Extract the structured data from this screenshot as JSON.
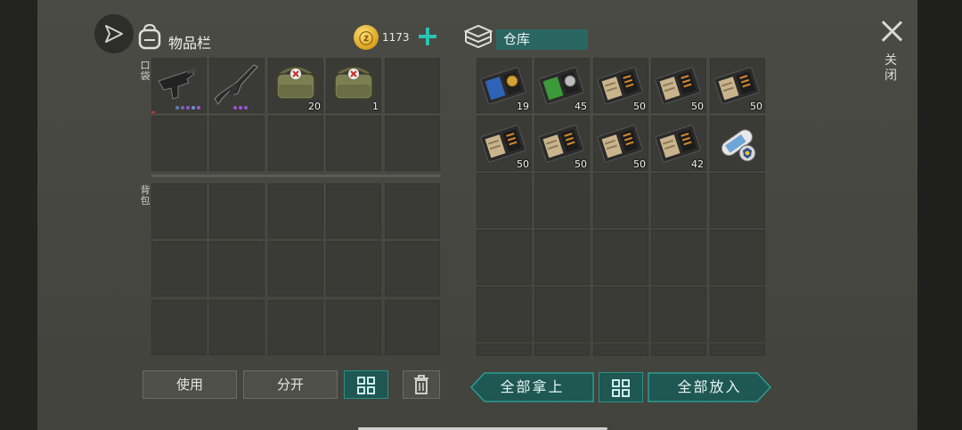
{
  "inventory": {
    "title": "物品栏",
    "coins": "1173",
    "pocket_label": "口袋",
    "backpack_label": "背包",
    "pocket_items": [
      {
        "name": "smg-item",
        "count": "",
        "dots": [
          "#5b7fb5",
          "#7a62c9",
          "#9a55d6",
          "#6f8fd0",
          "#9a55d6"
        ]
      },
      {
        "name": "rifle-item",
        "count": "",
        "dots": [
          "#9a55d6",
          "#9a55d6",
          "#9a55d6"
        ]
      },
      {
        "name": "medical-bag-item",
        "count": "20",
        "dots": []
      },
      {
        "name": "medical-bag-item",
        "count": "1",
        "dots": []
      }
    ]
  },
  "storage": {
    "title": "仓库",
    "items": [
      {
        "name": "blue-book-item",
        "count": "19"
      },
      {
        "name": "green-book-item",
        "count": "45"
      },
      {
        "name": "blueprint-book-item",
        "count": "50"
      },
      {
        "name": "blueprint-book-item",
        "count": "50"
      },
      {
        "name": "blueprint-book-item",
        "count": "50"
      },
      {
        "name": "blueprint-book-item",
        "count": "50"
      },
      {
        "name": "blueprint-book-item",
        "count": "50"
      },
      {
        "name": "blueprint-book-item",
        "count": "50"
      },
      {
        "name": "blueprint-book-item",
        "count": "42"
      },
      {
        "name": "scroll-badge-item",
        "count": ""
      }
    ]
  },
  "buttons": {
    "use": "使用",
    "split": "分开",
    "take_all": "全部拿上",
    "put_all": "全部放入",
    "close": "关闭"
  },
  "colors": {
    "accent": "#2a8f86",
    "teal_dark": "#1f5752",
    "coin": "#d9a220"
  }
}
